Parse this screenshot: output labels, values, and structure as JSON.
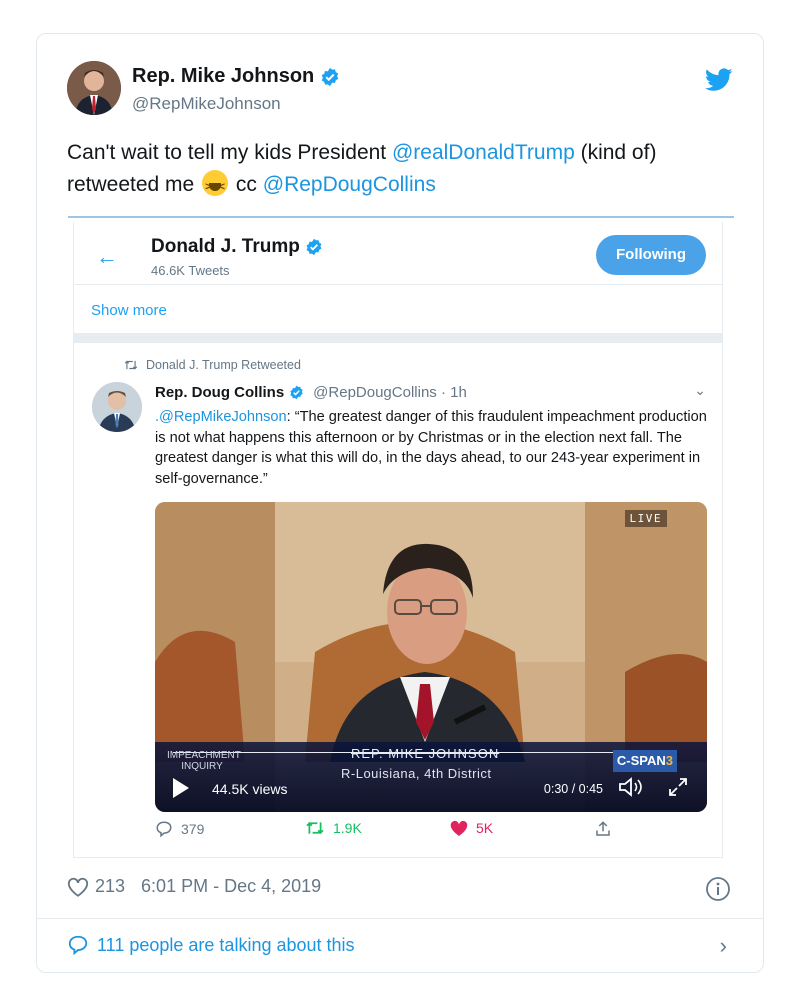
{
  "author": {
    "name": "Rep. Mike Johnson",
    "handle": "@RepMikeJohnson"
  },
  "tweet": {
    "text_1": "Can't wait to tell my kids President ",
    "mention_1": "@realDonaldTrump",
    "text_2": " (kind of) retweeted me ",
    "text_3": " cc ",
    "mention_2": "@RepDougCollins",
    "emoji": "laughing-squinting-face"
  },
  "embed": {
    "profile_name": "Donald J. Trump",
    "tweet_count": "46.6K Tweets",
    "following_label": "Following",
    "show_more": "Show more",
    "retweeted_label": "Donald J. Trump Retweeted",
    "quoted": {
      "name": "Rep. Doug Collins",
      "handle": "@RepDougCollins · 1h",
      "mention": ".@RepMikeJohnson",
      "text": ": “The greatest danger of this fraudulent impeachment production is not what happens this afternoon or by Christmas or in the election next fall. The greatest danger is what this will do, in the days ahead, to our 243-year experiment in self-governance.”"
    },
    "video": {
      "live": "LIVE",
      "tag_line1": "IMPEACHMENT",
      "tag_line2": "INQUIRY",
      "lower_name": "REP. MIKE JOHNSON",
      "lower_sub": "R-Louisiana, 4th District",
      "network": "C-SPAN",
      "network_num": "3",
      "views": "44.5K views",
      "time": "0:30 / 0:45",
      "progress_fraction": 0.667
    },
    "actions": {
      "replies": "379",
      "retweets": "1.9K",
      "likes": "5K"
    }
  },
  "footer": {
    "likes": "213",
    "timestamp": "6:01 PM - Dec 4, 2019",
    "talking": "111 people are talking about this"
  },
  "colors": {
    "link": "#1b95e0",
    "following_button": "#4aa3e8",
    "retweet": "#17bf63",
    "like": "#e0245e"
  }
}
